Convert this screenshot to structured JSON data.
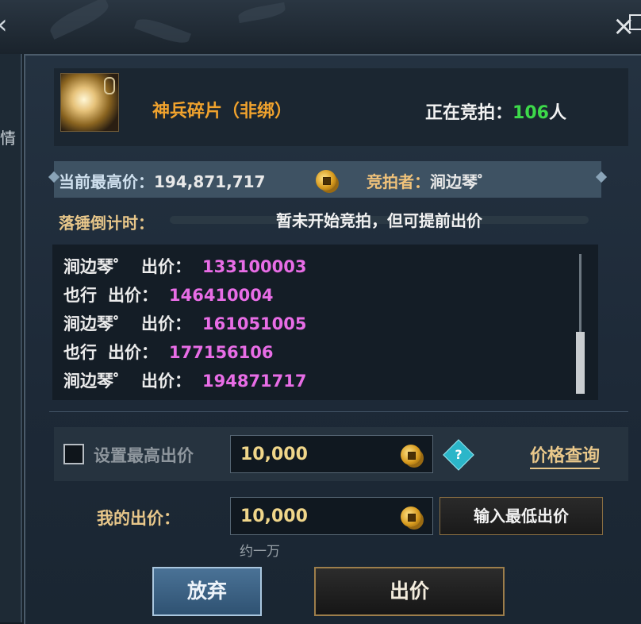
{
  "window": {
    "close_icon": "close-icon",
    "back_icon": "chevron-left-icon"
  },
  "side_panel": {
    "glyph": "情"
  },
  "item": {
    "name": "神兵碎片（非绑）",
    "icon": "divine-weapon-fragment-icon",
    "bidders_label": "正在竞拍：",
    "bidders_count": "106",
    "bidders_unit": "人"
  },
  "auction": {
    "highest_label": "当前最高价：",
    "highest_value": "194,871,717",
    "bidder_label": "竞拍者：",
    "bidder_name": "涧边琴゜",
    "countdown_label": "落锤倒计时：",
    "countdown_text": "暂未开始竞拍，但可提前出价"
  },
  "bid_log": [
    {
      "name": "涧边琴゜",
      "bid_label": "出价：",
      "amount": "133100003"
    },
    {
      "name": "也行",
      "bid_label": "出价：",
      "amount": "146410004"
    },
    {
      "name": "涧边琴゜",
      "bid_label": "出价：",
      "amount": "161051005"
    },
    {
      "name": "也行",
      "bid_label": "出价：",
      "amount": "177156106"
    },
    {
      "name": "涧边琴゜",
      "bid_label": "出价：",
      "amount": "194871717"
    }
  ],
  "max_bid": {
    "checkbox_label": "设置最高出价",
    "value": "10,000",
    "help_icon": "question-diamond-icon",
    "price_query": "价格查询"
  },
  "my_bid": {
    "label": "我的出价：",
    "value": "10,000",
    "min_bid_button": "输入最低出价",
    "approx": "约一万"
  },
  "buttons": {
    "abandon": "放弃",
    "bid": "出价"
  },
  "colors": {
    "accent_orange": "#f0a22d",
    "count_green": "#3dd94a",
    "bid_pink": "#e86de6",
    "gold": "#e8c78a"
  }
}
